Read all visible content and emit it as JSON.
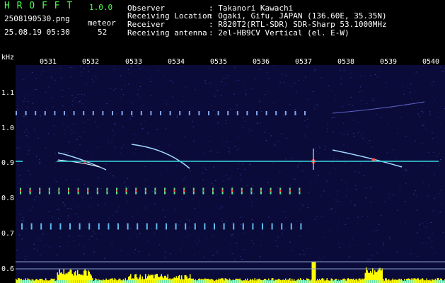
{
  "header": {
    "app_name": "H R O F F T",
    "version": "1.0.0",
    "filename": "2508190530.png",
    "datetime": "25.08.19 05:30",
    "mode_label": "meteor",
    "meteor_count": "52",
    "fields": [
      {
        "label": "Observer",
        "value": ": Takanori Kawachi"
      },
      {
        "label": "Receiving Location",
        "value": ": Ogaki, Gifu, JAPAN (136.60E, 35.35N)"
      },
      {
        "label": "Receiver",
        "value": ": R820T2(RTL-SDR) SDR-Sharp 53.1000MHz"
      },
      {
        "label": "Receiving antenna",
        "value": ": 2el-HB9CV Vertical (el. E-W)"
      }
    ]
  },
  "spectrogram": {
    "y_unit": "kHz",
    "time_ticks": [
      "0531",
      "0532",
      "0533",
      "0534",
      "0535",
      "0536",
      "0537",
      "0538",
      "0539",
      "0540"
    ],
    "freq_ticks": [
      "1.1",
      "1.0",
      "0.9",
      "0.8",
      "0.7",
      "0.6"
    ],
    "colors": {
      "background": "#0b0b3a",
      "carrier": "#37d7e0",
      "level": "#ffff00",
      "grid_line": "#8aa0c8"
    }
  }
}
